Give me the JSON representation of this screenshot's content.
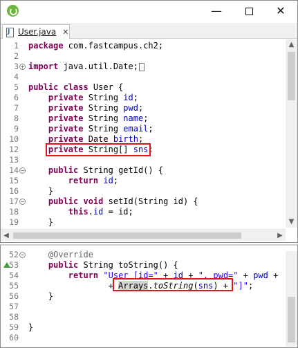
{
  "window": {
    "minimize_glyph": "—",
    "close_glyph": "✕",
    "tab": {
      "label": "User.java",
      "close_glyph": "✕"
    }
  },
  "editor_top": {
    "lines": [
      {
        "n": "1",
        "fold": "",
        "code": [
          [
            "kw",
            "package"
          ],
          [
            "t",
            " com.fastcampus.ch2;"
          ]
        ]
      },
      {
        "n": "2",
        "fold": "",
        "code": []
      },
      {
        "n": "3",
        "fold": "+",
        "code": [
          [
            "kw",
            "import"
          ],
          [
            "t",
            " java.util.Date;"
          ]
        ],
        "collapsed": true
      },
      {
        "n": "4",
        "fold": "",
        "code": []
      },
      {
        "n": "5",
        "fold": "",
        "code": [
          [
            "kw",
            "public class"
          ],
          [
            "t",
            " User {"
          ]
        ]
      },
      {
        "n": "6",
        "fold": "",
        "code": [
          [
            "t",
            "    "
          ],
          [
            "kw",
            "private"
          ],
          [
            "t",
            " String "
          ],
          [
            "fld",
            "id"
          ],
          [
            "t",
            ";"
          ]
        ]
      },
      {
        "n": "7",
        "fold": "",
        "code": [
          [
            "t",
            "    "
          ],
          [
            "kw",
            "private"
          ],
          [
            "t",
            " String "
          ],
          [
            "fld",
            "pwd"
          ],
          [
            "t",
            ";"
          ]
        ]
      },
      {
        "n": "8",
        "fold": "",
        "code": [
          [
            "t",
            "    "
          ],
          [
            "kw",
            "private"
          ],
          [
            "t",
            " String "
          ],
          [
            "fld",
            "name"
          ],
          [
            "t",
            ";"
          ]
        ]
      },
      {
        "n": "9",
        "fold": "",
        "code": [
          [
            "t",
            "    "
          ],
          [
            "kw",
            "private"
          ],
          [
            "t",
            " String "
          ],
          [
            "fld",
            "email"
          ],
          [
            "t",
            ";"
          ]
        ]
      },
      {
        "n": "10",
        "fold": "",
        "code": [
          [
            "t",
            "    "
          ],
          [
            "kw",
            "private"
          ],
          [
            "t",
            " Date "
          ],
          [
            "fld",
            "birth"
          ],
          [
            "t",
            ";"
          ]
        ]
      },
      {
        "n": "12",
        "fold": "",
        "code": [
          [
            "t",
            "    "
          ],
          [
            "kw",
            "private"
          ],
          [
            "t",
            " String[] "
          ],
          [
            "fld",
            "sns"
          ],
          [
            "t",
            ";"
          ]
        ]
      },
      {
        "n": "13",
        "fold": "",
        "code": []
      },
      {
        "n": "14",
        "fold": "−",
        "code": [
          [
            "t",
            "    "
          ],
          [
            "kw",
            "public"
          ],
          [
            "t",
            " String getId() {"
          ]
        ]
      },
      {
        "n": "15",
        "fold": "",
        "code": [
          [
            "t",
            "        "
          ],
          [
            "kw",
            "return"
          ],
          [
            "t",
            " "
          ],
          [
            "fld",
            "id"
          ],
          [
            "t",
            ";"
          ]
        ]
      },
      {
        "n": "16",
        "fold": "",
        "code": [
          [
            "t",
            "    }"
          ]
        ]
      },
      {
        "n": "17",
        "fold": "−",
        "code": [
          [
            "t",
            "    "
          ],
          [
            "kw",
            "public void"
          ],
          [
            "t",
            " setId(String id) {"
          ]
        ]
      },
      {
        "n": "18",
        "fold": "",
        "code": [
          [
            "t",
            "        "
          ],
          [
            "kw",
            "this"
          ],
          [
            "t",
            "."
          ],
          [
            "fld",
            "id"
          ],
          [
            "t",
            " = id;"
          ]
        ]
      },
      {
        "n": "19",
        "fold": "",
        "code": [
          [
            "t",
            "    }"
          ]
        ]
      }
    ]
  },
  "editor_bottom": {
    "lines": [
      {
        "n": "52",
        "fold": "−",
        "code": [
          [
            "t",
            "    "
          ],
          [
            "ann",
            "@Override"
          ]
        ]
      },
      {
        "n": "53",
        "fold": "",
        "override": true,
        "code": [
          [
            "t",
            "    "
          ],
          [
            "kw",
            "public"
          ],
          [
            "t",
            " String toString() {"
          ]
        ]
      },
      {
        "n": "54",
        "fold": "",
        "code": [
          [
            "t",
            "        "
          ],
          [
            "kw",
            "return"
          ],
          [
            "t",
            " "
          ],
          [
            "str",
            "\"User [id=\""
          ],
          [
            "t",
            " + "
          ],
          [
            "fld",
            "id"
          ],
          [
            "t",
            " + "
          ],
          [
            "str",
            "\", pwd=\""
          ],
          [
            "t",
            " + "
          ],
          [
            "fld",
            "pwd"
          ],
          [
            "t",
            " + "
          ]
        ]
      },
      {
        "n": "55",
        "fold": "",
        "code": [
          [
            "t",
            "                + "
          ],
          [
            "hl",
            "Arrays"
          ],
          [
            "t",
            "."
          ],
          [
            "itl",
            "toString"
          ],
          [
            "t",
            "("
          ],
          [
            "fld",
            "sns"
          ],
          [
            "t",
            ") + "
          ],
          [
            "str",
            "\"]\""
          ],
          [
            "t",
            ";"
          ]
        ]
      },
      {
        "n": "56",
        "fold": "",
        "code": [
          [
            "t",
            "    }"
          ]
        ]
      },
      {
        "n": "57",
        "fold": "",
        "code": []
      },
      {
        "n": "58",
        "fold": "",
        "code": []
      },
      {
        "n": "59",
        "fold": "",
        "code": [
          [
            "t",
            "}"
          ]
        ]
      },
      {
        "n": "60",
        "fold": "",
        "code": []
      }
    ]
  },
  "colors": {
    "keyword": "#7f0055",
    "field": "#0000c0",
    "string": "#2a00ff",
    "annotation": "#646464",
    "highlight_box": "#e0161b"
  }
}
